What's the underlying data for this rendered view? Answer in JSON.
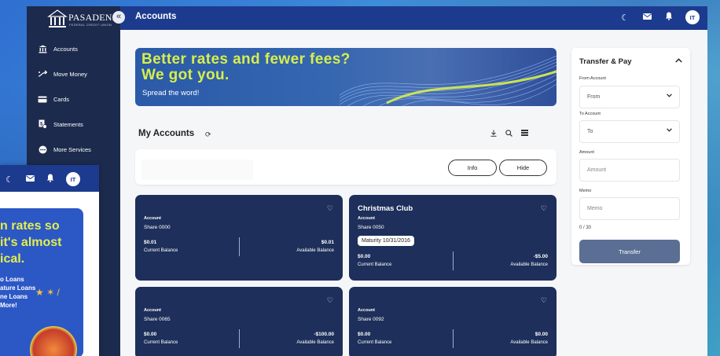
{
  "app": {
    "brand": "PASADENA",
    "brand_sub": "FEDERAL CREDIT UNION",
    "page_title": "Accounts",
    "avatar_initials": "IT"
  },
  "sidebar": {
    "items": [
      {
        "label": "Accounts",
        "icon": "bank-icon"
      },
      {
        "label": "Move Money",
        "icon": "transfer-icon"
      },
      {
        "label": "Cards",
        "icon": "card-icon"
      },
      {
        "label": "Statements",
        "icon": "statement-icon"
      },
      {
        "label": "More Services",
        "icon": "more-icon"
      }
    ]
  },
  "banner": {
    "line1": "Better rates and fewer fees?",
    "line2": "We got you.",
    "sub": "Spread the word!"
  },
  "accounts": {
    "title": "My Accounts",
    "info_label": "Info",
    "hide_label": "Hide",
    "cards": [
      {
        "name": "",
        "account_label": "Account",
        "share": "Share 0000",
        "maturity": "",
        "current": "$0.01",
        "available": "$0.01",
        "current_label": "Current Balance",
        "available_label": "Available Balance"
      },
      {
        "name": "Christmas Club",
        "account_label": "Account",
        "share": "Share 0050",
        "maturity": "Maturity 10/31/2016",
        "current": "$0.00",
        "available": "-$5.00",
        "current_label": "Current Balance",
        "available_label": "Available Balance"
      },
      {
        "name": "",
        "account_label": "Account",
        "share": "Share 0065",
        "maturity": "",
        "current": "$0.00",
        "available": "-$100.00",
        "current_label": "Current Balance",
        "available_label": "Available Balance"
      },
      {
        "name": "",
        "account_label": "Account",
        "share": "Share 0092",
        "maturity": "",
        "current": "$0.00",
        "available": "$0.00",
        "current_label": "Current Balance",
        "available_label": "Available Balance"
      }
    ]
  },
  "transfer": {
    "title": "Transfer & Pay",
    "from_label": "From Account",
    "from_value": "From",
    "to_label": "To Account",
    "to_value": "To",
    "amount_label": "Amount",
    "amount_placeholder": "Amount",
    "memo_label": "Memo",
    "memo_placeholder": "Memo",
    "memo_counter": "0 / 30",
    "button": "Transfer"
  },
  "mobile": {
    "avatar_initials": "IT",
    "promo_lines": [
      "n rates so",
      " it's almost",
      "ical."
    ],
    "promo_list": [
      "o Loans",
      "ature Loans",
      "ne Loans",
      " More!"
    ]
  },
  "colors": {
    "sidebar": "#1c2a4d",
    "topbar": "#1c3b8e",
    "card": "#1d2f5a",
    "accent": "#d8ef4a",
    "transfer_button": "#5b6f95"
  }
}
